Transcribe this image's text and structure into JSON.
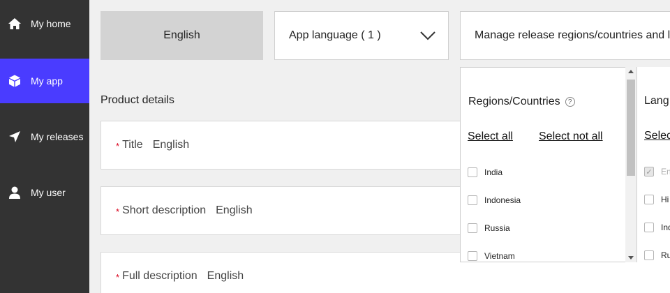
{
  "sidebar": {
    "items": [
      {
        "label": "My home",
        "icon": "home-icon",
        "active": false
      },
      {
        "label": "My app",
        "icon": "cube-icon",
        "active": true
      },
      {
        "label": "My releases",
        "icon": "send-icon",
        "active": false
      },
      {
        "label": "My user",
        "icon": "user-icon",
        "active": false
      }
    ]
  },
  "top": {
    "language_tab": "English",
    "app_language": "App language ( 1 )",
    "manage_regions": "Manage release regions/countries and l"
  },
  "product": {
    "section_title": "Product details",
    "required_mark": "*",
    "fields": [
      {
        "label": "Title",
        "lang": "English"
      },
      {
        "label": "Short description",
        "lang": "English"
      },
      {
        "label": "Full description",
        "lang": "English"
      }
    ]
  },
  "regions_panel": {
    "title": "Regions/Countries",
    "help": "?",
    "select_all": "Select all",
    "select_not_all": "Select not all",
    "options": [
      "India",
      "Indonesia",
      "Russia",
      "Vietnam"
    ]
  },
  "languages_panel": {
    "title": "Lang",
    "select": "Selec",
    "options": [
      {
        "label": "En",
        "checked": true
      },
      {
        "label": "Hi",
        "checked": false
      },
      {
        "label": "Ind",
        "checked": false
      },
      {
        "label": "Ru",
        "checked": false
      }
    ]
  },
  "colors": {
    "sidebar_bg": "#333333",
    "active_nav": "#4a3cff",
    "required": "#d9001b"
  }
}
